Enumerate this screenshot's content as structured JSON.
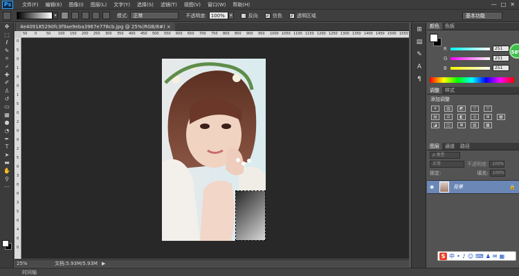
{
  "app": {
    "logo": "Ps"
  },
  "menu": [
    "文件(F)",
    "编辑(E)",
    "图像(I)",
    "图层(L)",
    "文字(Y)",
    "选择(S)",
    "滤镜(T)",
    "视图(V)",
    "窗口(W)",
    "帮助(H)"
  ],
  "window_controls": [
    "—",
    "□",
    "✕"
  ],
  "options": {
    "mode_label": "模式:",
    "mode_value": "正常",
    "opacity_label": "不透明度:",
    "opacity_value": "100%",
    "reverse_label": "反向",
    "dither_label": "仿色",
    "transparency_label": "透明区域",
    "workspace": "基本功能"
  },
  "document": {
    "tab_title": "4e409185290fc3f9ae9eba3967e778cb.jpg @ 25%(RGB/8#) ×",
    "ruler_h": [
      "50",
      "0",
      "50",
      "100",
      "150",
      "200",
      "250",
      "300",
      "350",
      "400",
      "450",
      "500",
      "550",
      "600",
      "650",
      "700",
      "750",
      "800",
      "850",
      "900",
      "950",
      "1000",
      "1050",
      "1100",
      "1150",
      "1200",
      "1250",
      "1300",
      "1350",
      "1400",
      "1450",
      "1500",
      "1550"
    ],
    "ruler_v": [
      "0",
      "5",
      "0",
      "1",
      "0",
      "0",
      "1",
      "5",
      "0",
      "2",
      "0",
      "0",
      "2",
      "5",
      "0",
      "3",
      "0",
      "0",
      "3",
      "5",
      "0",
      "4",
      "0",
      "0"
    ]
  },
  "status": {
    "zoom": "25%",
    "doc_info": "文档:5.93M/5.93M",
    "arrow": "▶",
    "timeline": "时间轴"
  },
  "color_panel": {
    "tabs": [
      "颜色",
      "色板"
    ],
    "r_label": "R",
    "r_value": "251",
    "g_label": "G",
    "g_value": "251",
    "b_label": "B",
    "b_value": "251"
  },
  "adjust_panel": {
    "tabs": [
      "调整",
      "样式"
    ],
    "title": "添加调整",
    "icons": [
      "☀",
      "▥",
      "◩",
      "▽",
      "▽",
      "",
      "▤",
      "⚖",
      "◧",
      "◎",
      "⊞",
      "▦",
      "◪",
      "◫",
      "⊠",
      "▧",
      "▩",
      ""
    ]
  },
  "layers_panel": {
    "tabs": [
      "图层",
      "通道",
      "路径"
    ],
    "filter_label": "ρ 类型",
    "blend": "正常",
    "opacity_label": "不透明度:",
    "opacity_value": "100%",
    "lock_label": "锁定:",
    "fill_label": "填充:",
    "fill_value": "100%",
    "layer_name": "背景"
  },
  "ime": {
    "logo": "S",
    "items": [
      "中",
      "•",
      "♪",
      "☺",
      "⌨",
      "♟",
      "✉",
      "▦"
    ]
  },
  "badge": {
    "text": "58%"
  },
  "colors": {
    "accent": "#6a87b6",
    "bg": "#535353",
    "canvas": "#282828"
  }
}
